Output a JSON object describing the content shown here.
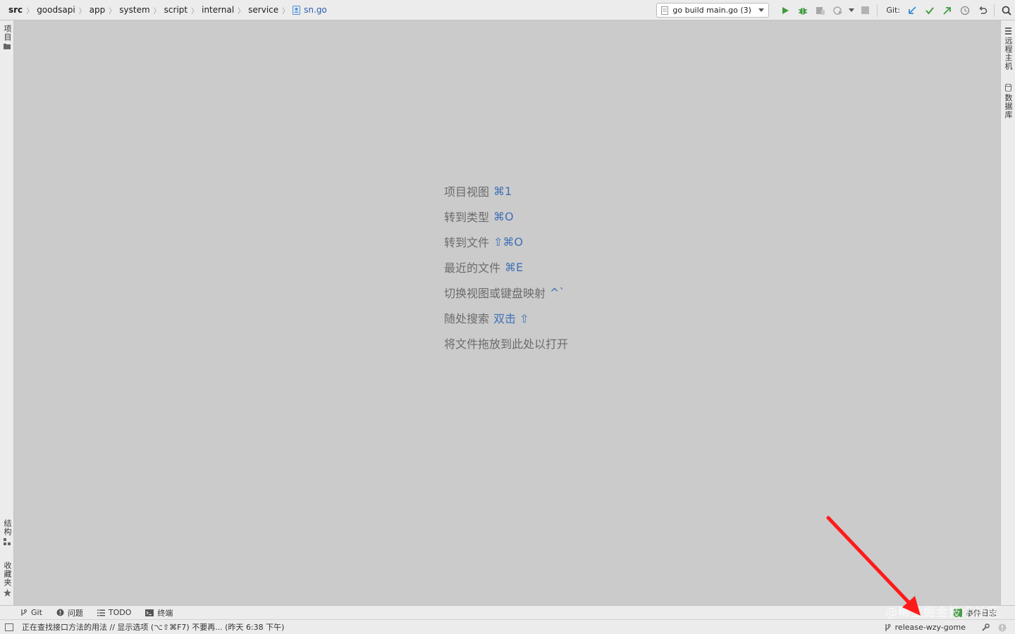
{
  "breadcrumb": {
    "items": [
      "src",
      "goodsapi",
      "app",
      "system",
      "script",
      "internal",
      "service"
    ],
    "file": "sn.go"
  },
  "toolbar": {
    "run_config": "go build main.go (3)",
    "git_label": "Git:",
    "colors": {
      "run": "#3e9d3e",
      "debug": "#3e9d3e",
      "git_update": "#3a8fd8",
      "git_commit": "#3e9d3e",
      "git_push": "#3e9d3e"
    },
    "icons": [
      "run-icon",
      "debug-icon",
      "coverage-icon",
      "profile-icon",
      "stop-icon",
      "git-update-icon",
      "git-commit-icon",
      "git-push-icon",
      "history-icon",
      "rollback-icon",
      "search-icon"
    ]
  },
  "left_strip": {
    "top": "项目",
    "structure": "结构",
    "favorites": "收藏夹"
  },
  "right_strip": {
    "remote_host": "远程主机",
    "database": "数据库"
  },
  "hints": [
    {
      "label": "项目视图",
      "key": "⌘1"
    },
    {
      "label": "转到类型",
      "key": "⌘O"
    },
    {
      "label": "转到文件",
      "key": "⇧⌘O"
    },
    {
      "label": "最近的文件",
      "key": "⌘E"
    },
    {
      "label": "切换视图或键盘映射",
      "key": "^`"
    },
    {
      "label": "随处搜索",
      "key": "双击 ⇧"
    },
    {
      "label": "将文件拖放到此处以打开",
      "key": ""
    }
  ],
  "bottom_tabs": {
    "git": "Git",
    "problems": "问题",
    "todo": "TODO",
    "terminal": "终端",
    "event_log": "事件日志"
  },
  "status": {
    "message": "正在查找接口方法的用法 // 显示选项 (⌥⇧⌘F7)   不要再... (昨天 6:38 下午)",
    "branch": "release-wzy-gome"
  },
  "watermark": "@稀土掘金技术社区",
  "annotation": {
    "arrow_color": "#ff1a1a"
  }
}
